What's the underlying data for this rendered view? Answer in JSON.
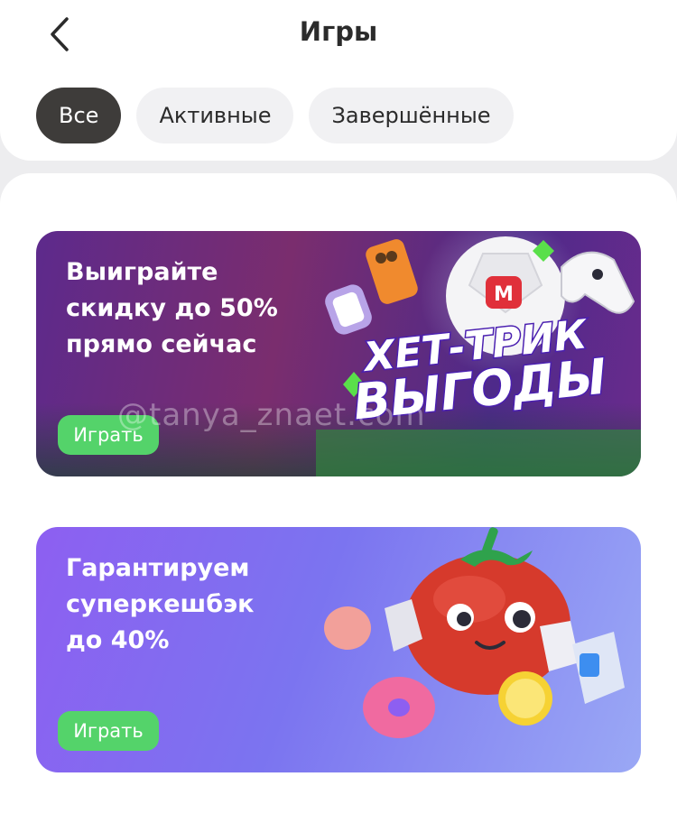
{
  "header": {
    "title": "Игры"
  },
  "filters": [
    {
      "label": "Все",
      "active": true
    },
    {
      "label": "Активные",
      "active": false
    },
    {
      "label": "Завершённые",
      "active": false
    }
  ],
  "games": [
    {
      "text_lines": [
        "Выиграйте",
        "скидку до 50%",
        "прямо сейчас"
      ],
      "button": "Играть",
      "art_title_1": "ХЕТ-ТРИК",
      "art_title_2": "ВЫГОДЫ",
      "ball_logo": "М"
    },
    {
      "text_lines": [
        "Гарантируем",
        "суперкешбэк",
        "до 40%"
      ],
      "button": "Играть"
    }
  ],
  "watermark": "@tanya_znaet.com",
  "colors": {
    "active_chip": "#3e3c3a",
    "chip": "#f1f1f3",
    "play_button": "#54d36a",
    "card1_bg": "#5d2a8c",
    "card2_bg": "#8d5ff1"
  },
  "icons": {
    "back": "chevron-left-icon"
  }
}
